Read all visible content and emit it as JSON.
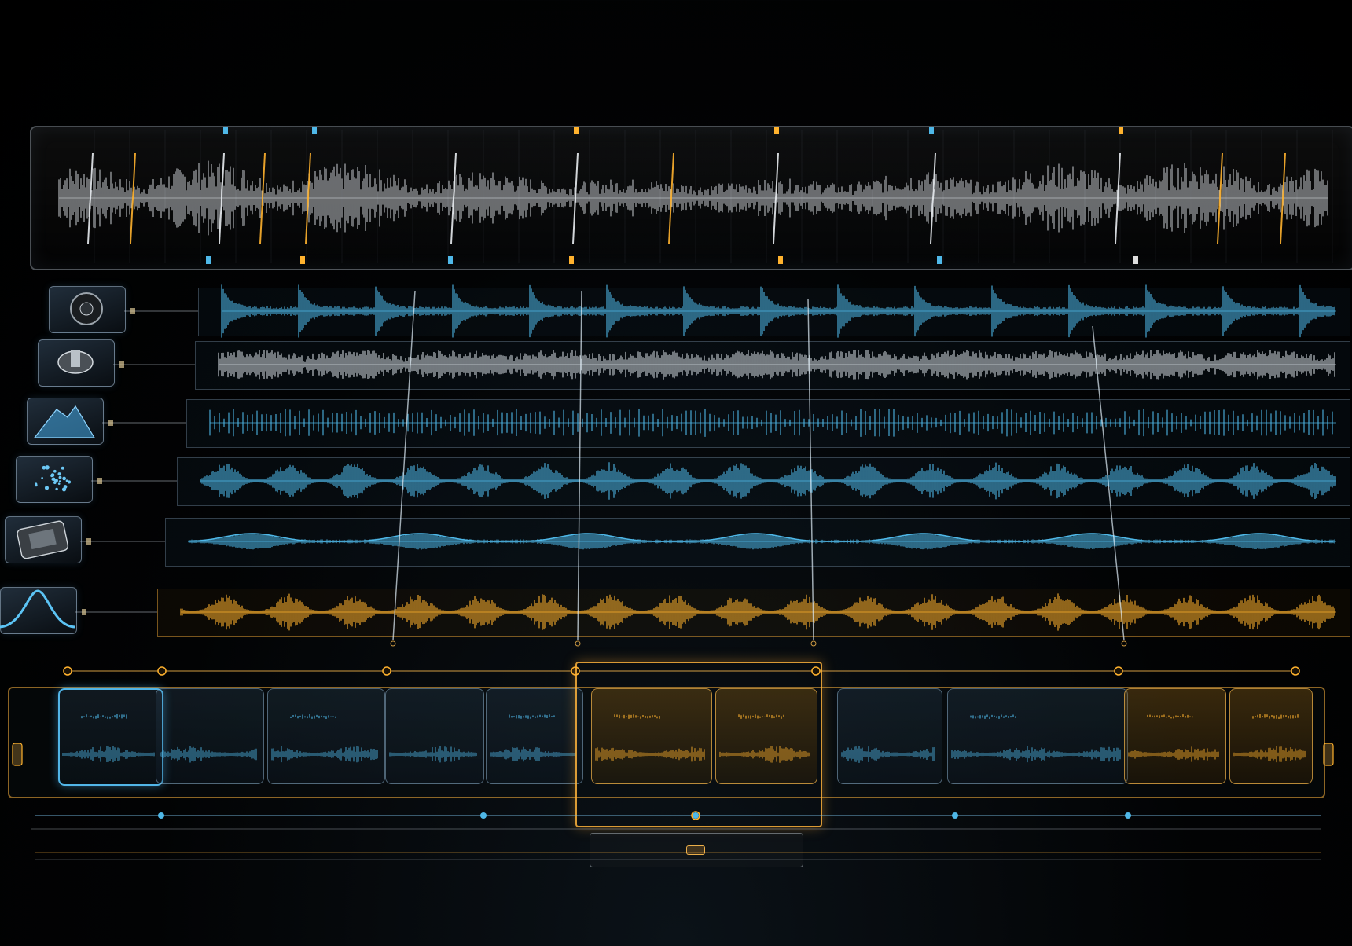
{
  "colors": {
    "background": "#000000",
    "master_wave": "#d9dde2",
    "accent_blue": "#4fb8e8",
    "accent_orange": "#ffb22e",
    "frame": "#c9d6e3"
  },
  "tracks": [
    {
      "icon": "speaker-icon",
      "wave_color": "#4fb8e8",
      "style": "transient"
    },
    {
      "icon": "cymbal-icon",
      "wave_color": "#cfd6dc",
      "style": "dense"
    },
    {
      "icon": "mountain-icon",
      "wave_color": "#4fb8e8",
      "style": "comb"
    },
    {
      "icon": "particles-icon",
      "wave_color": "#4fb8e8",
      "style": "bursts"
    },
    {
      "icon": "engine-icon",
      "wave_color": "#4fb8e8",
      "style": "smooth"
    },
    {
      "icon": "bell-curve-icon",
      "wave_color": "#ffb22e",
      "style": "bursts"
    }
  ],
  "clips": [
    {
      "state": "selected"
    },
    {
      "state": "normal"
    },
    {
      "state": "normal"
    },
    {
      "state": "normal"
    },
    {
      "state": "normal"
    },
    {
      "state": "highlighted"
    },
    {
      "state": "highlighted"
    },
    {
      "state": "normal"
    },
    {
      "state": "normal"
    },
    {
      "state": "highlighted"
    },
    {
      "state": "highlighted"
    }
  ]
}
